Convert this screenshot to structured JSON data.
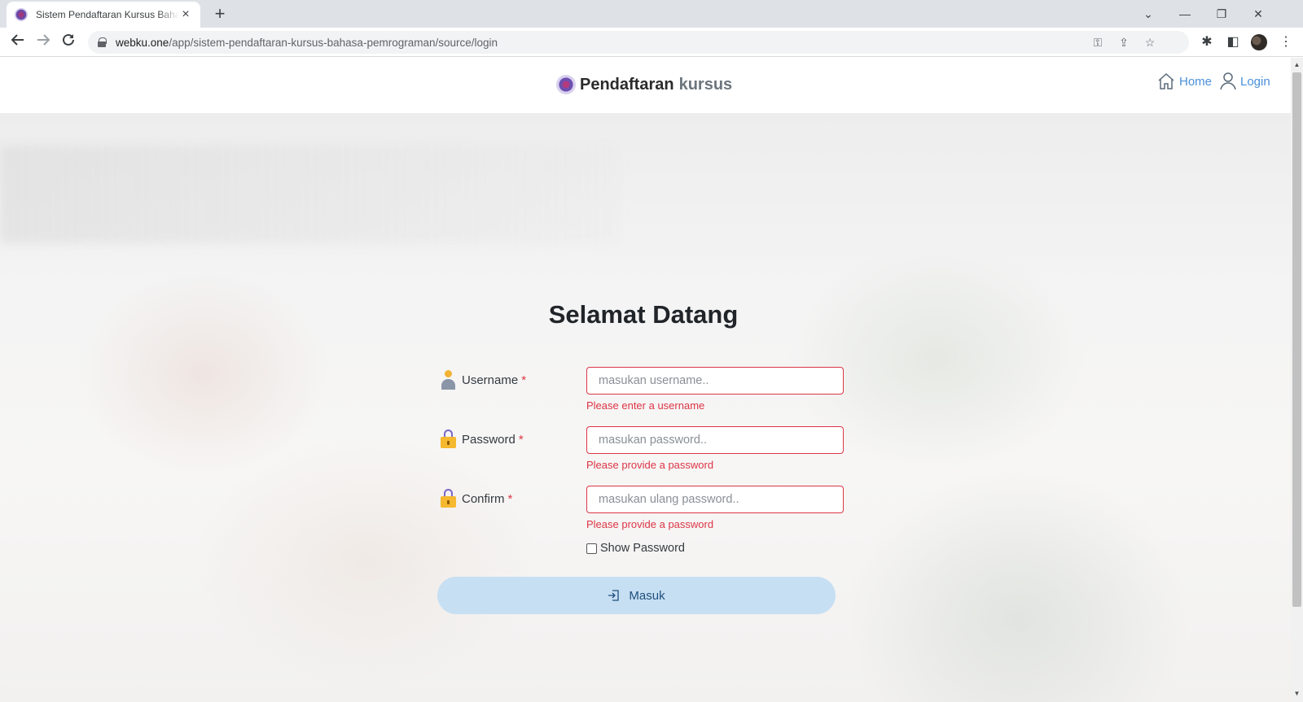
{
  "browser": {
    "tab_title": "Sistem Pendaftaran Kursus Bahasa Pemrograman",
    "new_tab": "+",
    "url_domain": "webku.one",
    "url_path": "/app/sistem-pendaftaran-kursus-bahasa-pemrograman/source/login"
  },
  "navbar": {
    "brand": "Pendaftaran",
    "brand_sub": "kursus",
    "links": [
      {
        "label": "Home",
        "icon": "home-icon"
      },
      {
        "label": "Login",
        "icon": "user-icon"
      }
    ]
  },
  "form": {
    "title": "Selamat Datang",
    "username": {
      "label": "Username",
      "required": "*",
      "placeholder": "masukan username..",
      "error": "Please enter a username"
    },
    "password": {
      "label": "Password",
      "required": "*",
      "placeholder": "masukan password..",
      "error": "Please provide a password"
    },
    "confirm": {
      "label": "Confirm",
      "required": "*",
      "placeholder": "masukan ulang password..",
      "error": "Please provide a password"
    },
    "show_password": "Show Password",
    "submit": "Masuk"
  },
  "colors": {
    "error": "#dc3545",
    "link": "#4a90d9",
    "button_bg": "#c7dff3"
  }
}
